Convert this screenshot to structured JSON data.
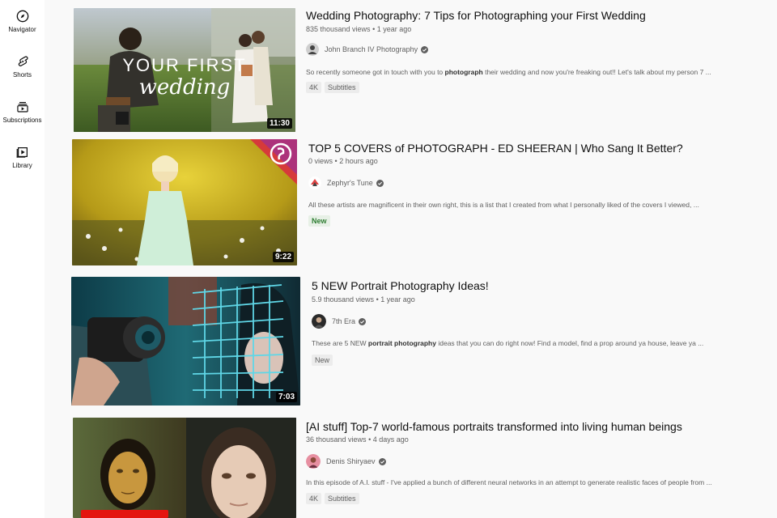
{
  "sidebar": {
    "items": [
      {
        "label": "Navigator",
        "icon": "compass-icon"
      },
      {
        "label": "Shorts",
        "icon": "shorts-icon"
      },
      {
        "label": "Subscriptions",
        "icon": "subscriptions-icon"
      },
      {
        "label": "Library",
        "icon": "library-icon"
      }
    ]
  },
  "videos": [
    {
      "title": "Wedding Photography: 7 Tips for Photographing your First Wedding",
      "views": "835 thousand views",
      "age": "1 year ago",
      "channel": "John Branch IV Photography",
      "desc_pre": "So recently someone got in touch with you to ",
      "desc_bold": "photograph",
      "desc_post": " their wedding and now you're freaking out!! Let's talk about my person 7 ...",
      "badges": [
        "4K",
        "Subtitles"
      ],
      "duration": "11:30",
      "thumb_text_1": "YOUR FIRST",
      "thumb_text_2": "wedding"
    },
    {
      "title": "TOP 5 COVERS of PHOTOGRAPH - ED SHEERAN | Who Sang It Better?",
      "views": "0 views",
      "age": "2 hours ago",
      "channel": "Zephyr's Tune",
      "desc_pre": "All these artists are magnificent in their own right, this is a list that I created from what I personally liked of the covers I viewed, ...",
      "desc_bold": "",
      "desc_post": "",
      "badges": [
        "New"
      ],
      "duration": "9:22"
    },
    {
      "title": "5 NEW Portrait Photography Ideas!",
      "views": "5.9 thousand views",
      "age": "1 year ago",
      "channel": "7th Era",
      "desc_pre": "These are 5 NEW ",
      "desc_bold": "portrait photography",
      "desc_post": " ideas that you can do right now! Find a model, find a prop around ya house, leave ya ...",
      "badges": [
        "New"
      ],
      "duration": "7:03"
    },
    {
      "title": "[AI stuff] Top-7 world-famous portraits transformed into living human beings",
      "views": "36 thousand views",
      "age": "4 days ago",
      "channel": "Denis Shiryaev",
      "desc_pre": "In this episode of A.I. stuff - I've applied a bunch of different neural networks in an attempt to generate realistic faces of people from ...",
      "desc_bold": "",
      "desc_post": "",
      "badges": [
        "4K",
        "Subtitles"
      ],
      "duration": ""
    }
  ],
  "colors": {
    "background": "#f9f9f9",
    "sidebar": "#ffffff",
    "new_badge": "#2e7d32"
  }
}
